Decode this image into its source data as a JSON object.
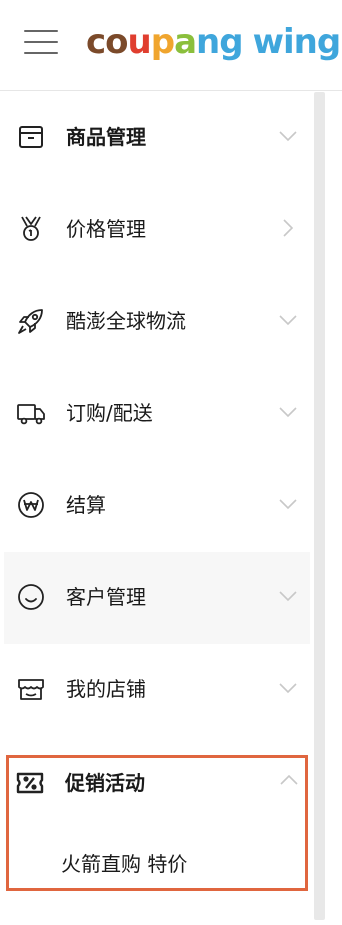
{
  "header": {
    "logo_letters": [
      {
        "ch": "c",
        "color": "#7b4a2a"
      },
      {
        "ch": "o",
        "color": "#7b4a2a"
      },
      {
        "ch": "u",
        "color": "#e03e2f"
      },
      {
        "ch": "p",
        "color": "#f0a52e"
      },
      {
        "ch": "a",
        "color": "#8bbf3c"
      },
      {
        "ch": "n",
        "color": "#3fa6dc"
      },
      {
        "ch": "g",
        "color": "#3fa6dc"
      },
      {
        "ch": " ",
        "color": "#ffffff"
      },
      {
        "ch": "w",
        "color": "#3fa6dc"
      },
      {
        "ch": "i",
        "color": "#3fa6dc"
      },
      {
        "ch": "n",
        "color": "#3fa6dc"
      },
      {
        "ch": "g",
        "color": "#3fa6dc"
      }
    ]
  },
  "sidebar": {
    "items": [
      {
        "label": "商品管理",
        "icon": "box-icon",
        "chevron": "down",
        "bold": true
      },
      {
        "label": "价格管理",
        "icon": "medal-icon",
        "chevron": "right",
        "bold": false
      },
      {
        "label": "酷澎全球物流",
        "icon": "rocket-icon",
        "chevron": "down",
        "bold": false
      },
      {
        "label": "订购/配送",
        "icon": "truck-icon",
        "chevron": "down",
        "bold": false
      },
      {
        "label": "结算",
        "icon": "won-coin-icon",
        "chevron": "down",
        "bold": false
      },
      {
        "label": "客户管理",
        "icon": "smile-icon",
        "chevron": "down",
        "bold": false
      },
      {
        "label": "我的店铺",
        "icon": "store-icon",
        "chevron": "down",
        "bold": false
      }
    ],
    "promo": {
      "label": "促销活动",
      "icon": "coupon-icon",
      "chevron": "up",
      "sub_items": [
        {
          "label": "火箭直购 特价"
        }
      ]
    }
  },
  "colors": {
    "highlight_border": "#e0663f",
    "scrollbar": "#e8e8e8",
    "hover_bg": "#f7f7f7",
    "chevron": "#c8c8c8"
  }
}
